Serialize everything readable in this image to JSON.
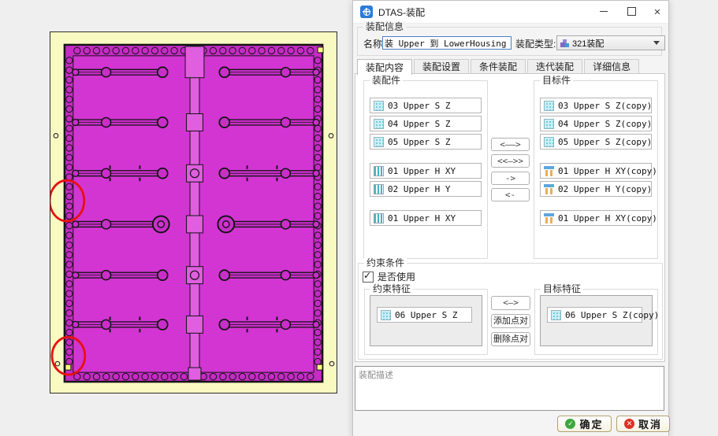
{
  "window": {
    "title": "DTAS-装配",
    "controls": [
      "minimize-icon",
      "maximize-icon",
      "close-icon"
    ]
  },
  "assembly_info": {
    "label": "装配信息",
    "name_label": "名称:",
    "name_value": "装 Upper 到 LowerHousing",
    "type_label": "装配类型:",
    "type_value": "321装配"
  },
  "tabs": [
    {
      "name": "tab-assembly-content",
      "label": "装配内容",
      "active": true
    },
    {
      "name": "tab-assembly-settings",
      "label": "装配设置",
      "active": false
    },
    {
      "name": "tab-conditional-assembly",
      "label": "条件装配",
      "active": false
    },
    {
      "name": "tab-iterative-assembly",
      "label": "迭代装配",
      "active": false
    },
    {
      "name": "tab-details",
      "label": "详细信息",
      "active": false
    }
  ],
  "parts_panel": {
    "source": {
      "label": "装配件",
      "items": [
        {
          "label": "03 Upper S Z",
          "icon": "surface",
          "gap": false
        },
        {
          "label": "04 Upper S Z",
          "icon": "surface",
          "gap": false
        },
        {
          "label": "05 Upper S Z",
          "icon": "surface",
          "gap": false
        },
        {
          "label": "01 Upper H XY",
          "icon": "hole",
          "gap": true
        },
        {
          "label": "02 Upper H Y",
          "icon": "hole",
          "gap": false
        },
        {
          "label": "01 Upper H XY",
          "icon": "hole",
          "gap": true
        }
      ]
    },
    "target": {
      "label": "目标件",
      "items": [
        {
          "label": "03 Upper S Z(copy)",
          "icon": "surface",
          "gap": false
        },
        {
          "label": "04 Upper S Z(copy)",
          "icon": "surface",
          "gap": false
        },
        {
          "label": "05 Upper S Z(copy)",
          "icon": "surface",
          "gap": false
        },
        {
          "label": "01 Upper H XY(copy)",
          "icon": "pin",
          "gap": true
        },
        {
          "label": "02 Upper H Y(copy)",
          "icon": "pin",
          "gap": false
        },
        {
          "label": "01 Upper H XY(copy)",
          "icon": "pin",
          "gap": true
        }
      ]
    },
    "transfer_buttons": [
      {
        "label": "<——>"
      },
      {
        "label": "<<—>>"
      },
      {
        "label": "->"
      },
      {
        "label": "<-"
      }
    ]
  },
  "constraint": {
    "label": "约束条件",
    "use_label": "是否使用",
    "use_checked": true,
    "source": {
      "label": "约束特征",
      "items": [
        {
          "label": "06 Upper S Z",
          "icon": "surface",
          "gap": false
        }
      ]
    },
    "target": {
      "label": "目标特征",
      "items": [
        {
          "label": "06 Upper S Z(copy)",
          "icon": "surface",
          "gap": false
        }
      ]
    },
    "buttons": [
      {
        "label": "<—>"
      },
      {
        "label": "添加点对"
      },
      {
        "label": "删除点对"
      }
    ]
  },
  "description": {
    "placeholder": "装配描述",
    "value": ""
  },
  "footer": {
    "ok_label": "确定",
    "cancel_label": "取消"
  },
  "viewport": {
    "background": "#f9f9c2",
    "panel_band": "#c52bc5",
    "panel_fill": "#d335d3",
    "rod_fill": "#c92ec9",
    "strip_fill": "#e05ee0",
    "outline": "#141414",
    "annotation": "#e81010",
    "annotations": [
      "left-edge-circle",
      "bottom-left-circle"
    ]
  }
}
